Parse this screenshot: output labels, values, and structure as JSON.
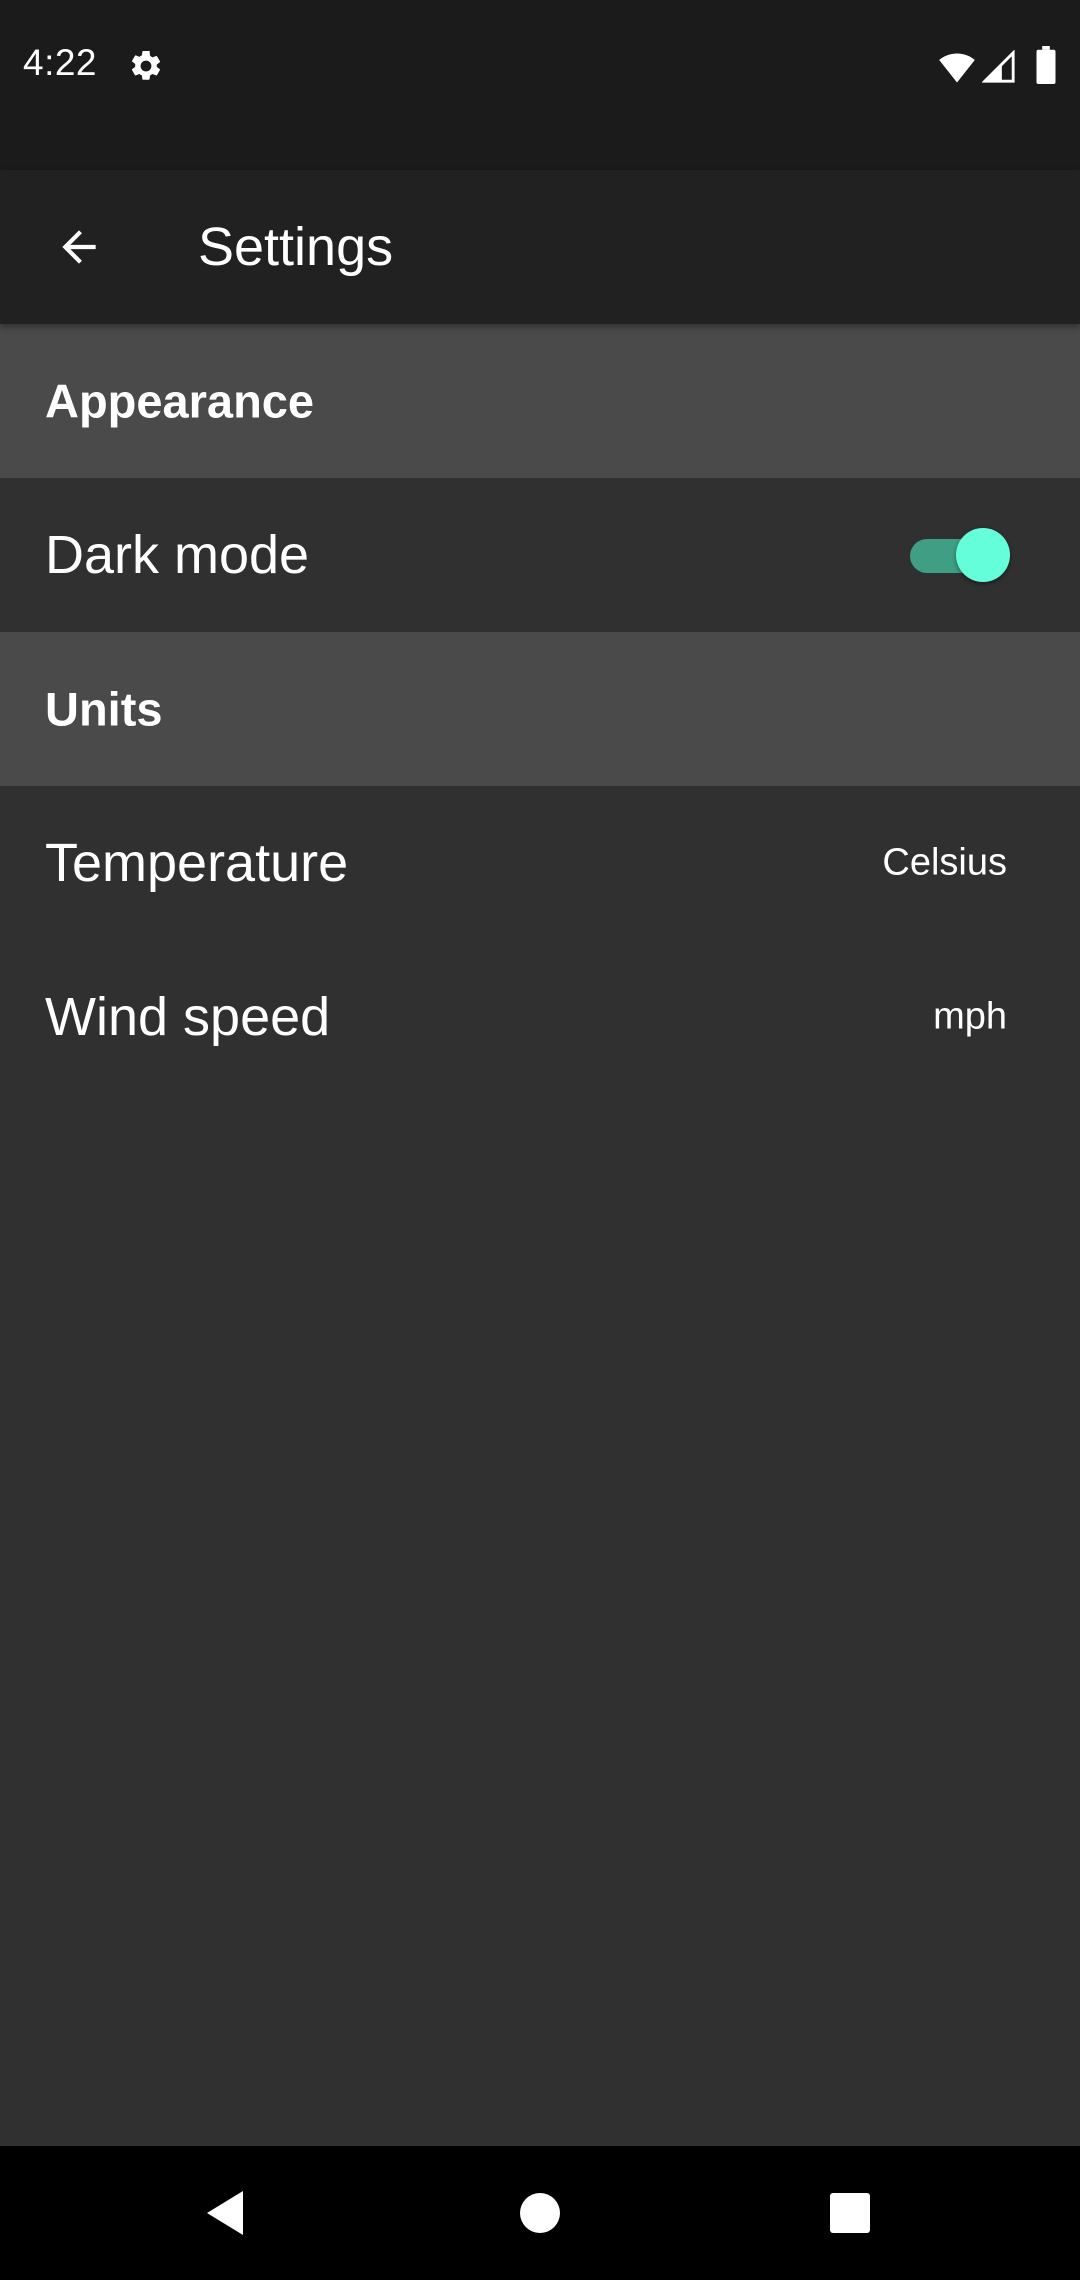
{
  "status_bar": {
    "time": "4:22",
    "icons": [
      "gear-icon",
      "wifi-icon",
      "signal-icon",
      "battery-icon"
    ]
  },
  "app_bar": {
    "back_icon": "arrow-back-icon",
    "title": "Settings"
  },
  "sections": [
    {
      "header": "Appearance",
      "items": [
        {
          "label": "Dark mode",
          "type": "toggle",
          "checked": true
        }
      ]
    },
    {
      "header": "Units",
      "items": [
        {
          "label": "Temperature",
          "type": "value",
          "value": "Celsius"
        },
        {
          "label": "Wind speed",
          "type": "value",
          "value": "mph"
        }
      ]
    }
  ],
  "nav_bar": {
    "buttons": [
      "back-triangle-icon",
      "home-circle-icon",
      "recents-square-icon"
    ]
  },
  "colors": {
    "status_bar_bg": "#1b1b1b",
    "app_bar_bg": "#212121",
    "background": "#303030",
    "section_header_bg": "#4a4a4a",
    "toggle_thumb": "#64ffda",
    "toggle_track": "#3f9e84",
    "nav_bar_bg": "#000000"
  }
}
